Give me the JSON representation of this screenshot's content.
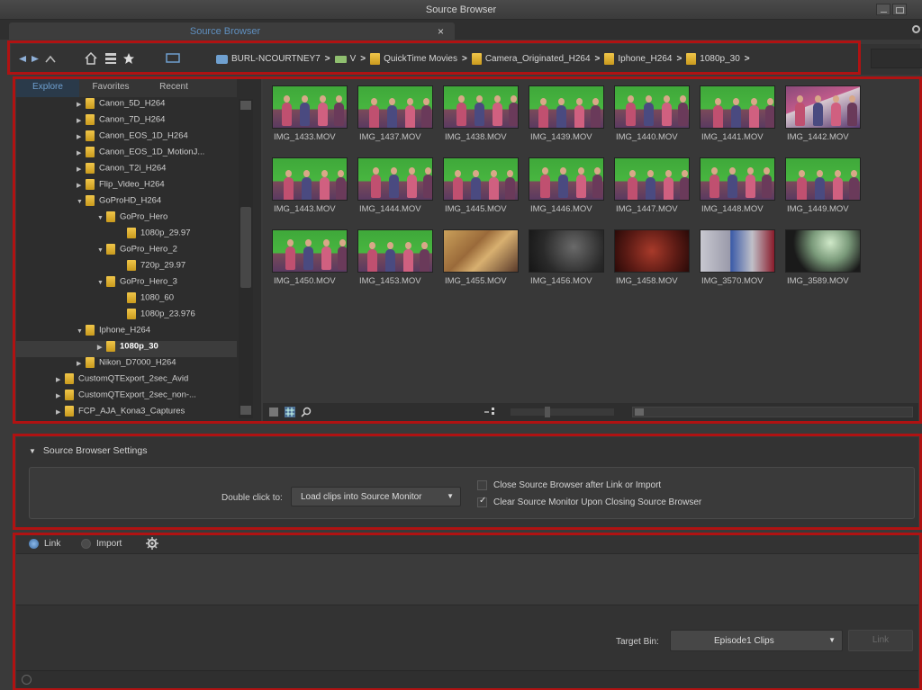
{
  "window": {
    "title": "Source Browser"
  },
  "tab": {
    "label": "Source Browser",
    "close": "×"
  },
  "breadcrumb": [
    {
      "label": "BURL-NCOURTNEY7",
      "icon": "computer-icon"
    },
    {
      "label": "V",
      "icon": "drive-icon"
    },
    {
      "label": "QuickTime Movies",
      "icon": "folder-icon"
    },
    {
      "label": "Camera_Originated_H264",
      "icon": "folder-icon"
    },
    {
      "label": "Iphone_H264",
      "icon": "folder-icon"
    },
    {
      "label": "1080p_30",
      "icon": "folder-icon"
    }
  ],
  "left_tabs": [
    "Explore",
    "Favorites",
    "Recent"
  ],
  "tree": [
    {
      "label": "Canon_5D_H264",
      "indent": 3,
      "expander": "collapsed"
    },
    {
      "label": "Canon_7D_H264",
      "indent": 3,
      "expander": "collapsed"
    },
    {
      "label": "Canon_EOS_1D_H264",
      "indent": 3,
      "expander": "collapsed"
    },
    {
      "label": "Canon_EOS_1D_MotionJ...",
      "indent": 3,
      "expander": "collapsed"
    },
    {
      "label": "Canon_T2i_H264",
      "indent": 3,
      "expander": "collapsed"
    },
    {
      "label": "Flip_Video_H264",
      "indent": 3,
      "expander": "collapsed"
    },
    {
      "label": "GoProHD_H264",
      "indent": 3,
      "expander": "expanded"
    },
    {
      "label": "GoPro_Hero",
      "indent": 4,
      "expander": "expanded"
    },
    {
      "label": "1080p_29.97",
      "indent": 5,
      "expander": "none"
    },
    {
      "label": "GoPro_Hero_2",
      "indent": 4,
      "expander": "expanded"
    },
    {
      "label": "720p_29.97",
      "indent": 5,
      "expander": "none"
    },
    {
      "label": "GoPro_Hero_3",
      "indent": 4,
      "expander": "expanded"
    },
    {
      "label": "1080_60",
      "indent": 5,
      "expander": "none"
    },
    {
      "label": "1080p_23.976",
      "indent": 5,
      "expander": "none"
    },
    {
      "label": "Iphone_H264",
      "indent": 3,
      "expander": "expanded"
    },
    {
      "label": "1080p_30",
      "indent": 4,
      "expander": "collapsed",
      "selected": true
    },
    {
      "label": "Nikon_D7000_H264",
      "indent": 3,
      "expander": "collapsed"
    },
    {
      "label": "CustomQTExport_2sec_Avid",
      "indent": 2,
      "expander": "collapsed"
    },
    {
      "label": "CustomQTExport_2sec_non-...",
      "indent": 2,
      "expander": "collapsed"
    },
    {
      "label": "FCP_AJA_Kona3_Captures",
      "indent": 2,
      "expander": "collapsed"
    }
  ],
  "clips": [
    {
      "name": "IMG_1433.MOV",
      "scene": "green"
    },
    {
      "name": "IMG_1437.MOV",
      "scene": "green"
    },
    {
      "name": "IMG_1438.MOV",
      "scene": "green"
    },
    {
      "name": "IMG_1439.MOV",
      "scene": "green"
    },
    {
      "name": "IMG_1440.MOV",
      "scene": "green"
    },
    {
      "name": "IMG_1441.MOV",
      "scene": "green"
    },
    {
      "name": "IMG_1442.MOV",
      "scene": "pink"
    },
    {
      "name": "IMG_1443.MOV",
      "scene": "green"
    },
    {
      "name": "IMG_1444.MOV",
      "scene": "green"
    },
    {
      "name": "IMG_1445.MOV",
      "scene": "green"
    },
    {
      "name": "IMG_1446.MOV",
      "scene": "green"
    },
    {
      "name": "IMG_1447.MOV",
      "scene": "green"
    },
    {
      "name": "IMG_1448.MOV",
      "scene": "green"
    },
    {
      "name": "IMG_1449.MOV",
      "scene": "green"
    },
    {
      "name": "IMG_1450.MOV",
      "scene": "green"
    },
    {
      "name": "IMG_1453.MOV",
      "scene": "green"
    },
    {
      "name": "IMG_1455.MOV",
      "scene": "crowd"
    },
    {
      "name": "IMG_1456.MOV",
      "scene": "dark"
    },
    {
      "name": "IMG_1458.MOV",
      "scene": "red"
    },
    {
      "name": "IMG_3570.MOV",
      "scene": "blue"
    },
    {
      "name": "IMG_3589.MOV",
      "scene": "stage"
    }
  ],
  "settings": {
    "heading": "Source Browser Settings",
    "double_click_label": "Double click to:",
    "double_click_value": "Load clips into Source Monitor",
    "close_after_link": {
      "label": "Close Source Browser after Link or Import",
      "checked": false
    },
    "clear_monitor": {
      "label": "Clear Source Monitor Upon Closing Source Browser",
      "checked": true
    }
  },
  "link_import": {
    "link_label": "Link",
    "import_label": "Import",
    "selected": "Link",
    "target_bin_label": "Target Bin:",
    "target_bin_value": "Episode1 Clips",
    "link_button": "Link"
  },
  "colors": {
    "highlight_box": "#b01212",
    "accent": "#5f8fbf"
  }
}
